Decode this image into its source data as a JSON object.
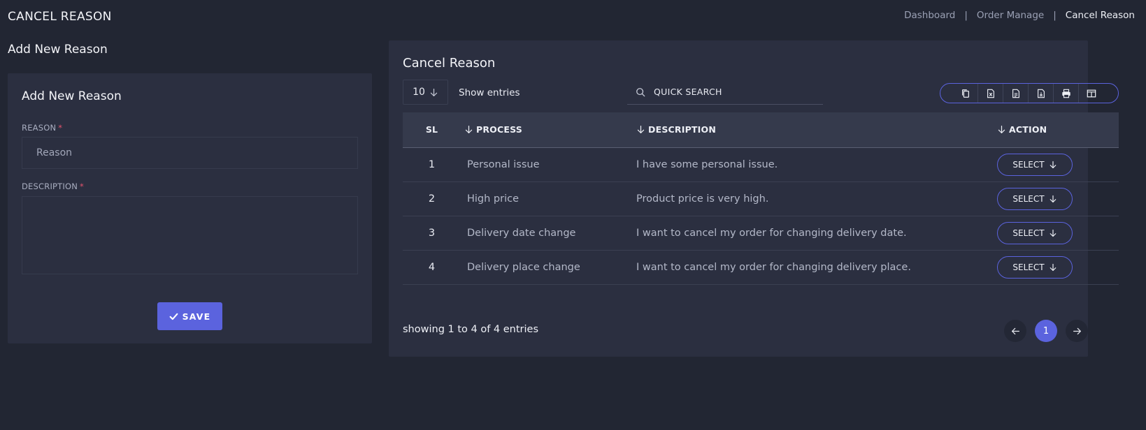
{
  "header": {
    "title": "CANCEL REASON",
    "breadcrumb": [
      "Dashboard",
      "Order Manage",
      "Cancel Reason"
    ]
  },
  "form": {
    "section_heading": "Add New Reason",
    "card_title": "Add New Reason",
    "reason_label": "REASON",
    "reason_placeholder": "Reason",
    "description_label": "DESCRIPTION",
    "required_mark": "*",
    "save_label": "SAVE"
  },
  "list": {
    "card_title": "Cancel Reason",
    "page_size": "10",
    "show_entries_label": "Show entries",
    "search_placeholder": "QUICK SEARCH",
    "toolbar_icons": [
      "copy-icon",
      "excel-icon",
      "csv-icon",
      "pdf-icon",
      "print-icon",
      "columns-icon"
    ],
    "columns": [
      "SL",
      "PROCESS",
      "DESCRIPTION",
      "ACTION"
    ],
    "rows": [
      {
        "sl": "1",
        "process": "Personal issue",
        "description": "I have some personal issue.",
        "action": "SELECT"
      },
      {
        "sl": "2",
        "process": "High price",
        "description": "Product price is very high.",
        "action": "SELECT"
      },
      {
        "sl": "3",
        "process": "Delivery date change",
        "description": "I want to cancel my order for changing delivery date.",
        "action": "SELECT"
      },
      {
        "sl": "4",
        "process": "Delivery place change",
        "description": "I want to cancel my order for changing delivery place.",
        "action": "SELECT"
      }
    ],
    "showing_text": "showing 1 to 4 of 4 entries",
    "current_page": "1"
  },
  "colors": {
    "accent": "#5b63de",
    "background": "#222633",
    "card": "#2b2f40",
    "required": "#e4546d"
  }
}
